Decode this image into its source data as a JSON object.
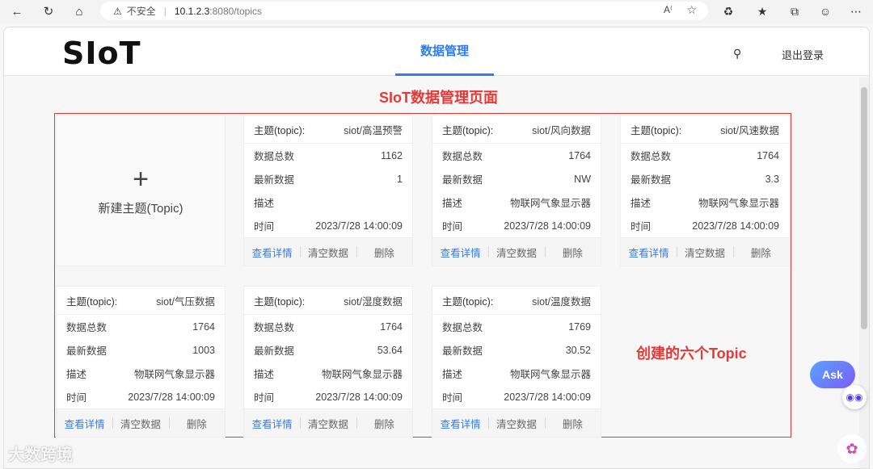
{
  "browser": {
    "warning_label": "不安全",
    "url_host": "10.1.2.3",
    "url_path": ":8080/topics"
  },
  "header": {
    "logo": "SIoT",
    "nav_active": "数据管理",
    "logout": "退出登录"
  },
  "annotations": {
    "title": "SIoT数据管理页面",
    "note": "创建的六个Topic"
  },
  "new_topic": {
    "label": "新建主题(Topic)"
  },
  "card_labels": {
    "topic": "主题(topic):",
    "total": "数据总数",
    "latest": "最新数据",
    "desc": "描述",
    "time": "时间",
    "view": "查看详情",
    "clear": "清空数据",
    "delete": "删除"
  },
  "topics": [
    {
      "name": "siot/高温预警",
      "total": "1162",
      "latest": "1",
      "desc": "",
      "time": "2023/7/28 14:00:09"
    },
    {
      "name": "siot/风向数据",
      "total": "1764",
      "latest": "NW",
      "desc": "物联网气象显示器",
      "time": "2023/7/28 14:00:09"
    },
    {
      "name": "siot/风速数据",
      "total": "1764",
      "latest": "3.3",
      "desc": "物联网气象显示器",
      "time": "2023/7/28 14:00:09"
    },
    {
      "name": "siot/气压数据",
      "total": "1764",
      "latest": "1003",
      "desc": "物联网气象显示器",
      "time": "2023/7/28 14:00:09"
    },
    {
      "name": "siot/湿度数据",
      "total": "1764",
      "latest": "53.64",
      "desc": "物联网气象显示器",
      "time": "2023/7/28 14:00:09"
    },
    {
      "name": "siot/温度数据",
      "total": "1769",
      "latest": "30.52",
      "desc": "物联网气象显示器",
      "time": "2023/7/28 14:00:09"
    }
  ],
  "floating": {
    "ask": "Ask"
  },
  "watermark": "大数跨境",
  "icons": [
    "back-icon",
    "refresh-icon",
    "home-icon",
    "warning-icon",
    "read-aloud-icon",
    "favorite-icon",
    "extensions-icon",
    "favorites-bar-icon",
    "collections-icon",
    "profile-icon",
    "more-icon",
    "search-icon",
    "plus-icon",
    "bot-icon",
    "brain-icon"
  ]
}
